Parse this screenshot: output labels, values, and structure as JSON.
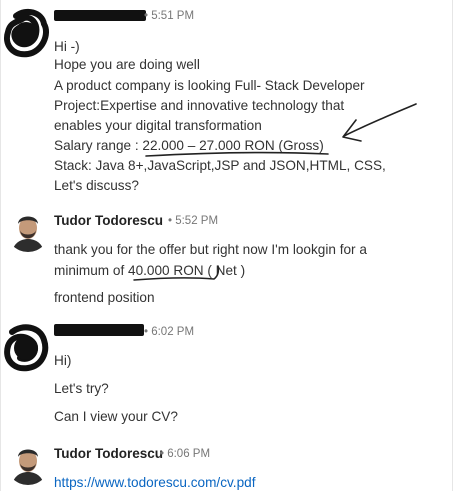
{
  "messages": [
    {
      "time": "• 5:51 PM",
      "lines": [
        "Hi -)",
        "Hope you are doing well",
        "A product company is looking Full- Stack Developer",
        "Project:Expertise and innovative technology that",
        "enables your digital transformation",
        "Salary range : 22.000 – 27.000 RON (Gross)",
        "Stack: Java 8+,JavaScript,JSP and JSON,HTML, CSS,",
        "Let's discuss?"
      ]
    },
    {
      "sender": "Tudor Todorescu",
      "time": "• 5:52 PM",
      "lines": [
        "thank you for the offer but right now I'm lookgin for a",
        "minimum of 40.000 RON ( Net )",
        "frontend position"
      ]
    },
    {
      "time": "• 6:02 PM",
      "lines": [
        "Hi)",
        "Let's try?",
        "Can I view your CV?"
      ]
    },
    {
      "sender": "Tudor Todorescu",
      "time": "• 6:06 PM",
      "link": "https://www.todorescu.com/cv.pdf"
    }
  ]
}
